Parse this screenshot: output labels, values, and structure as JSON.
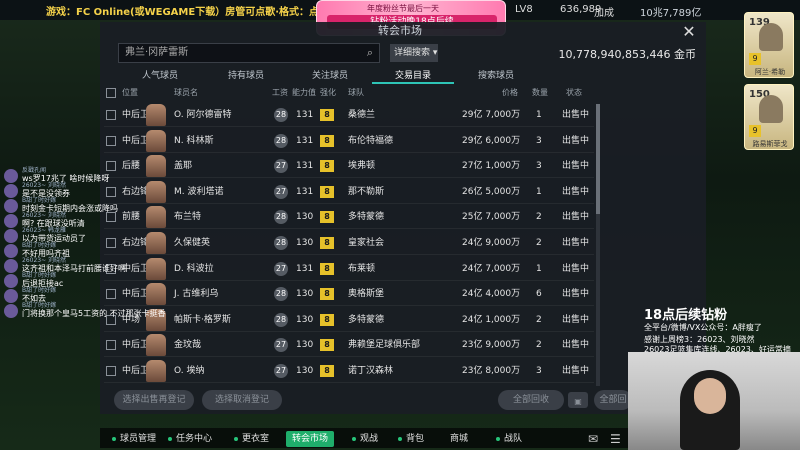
{
  "top": {
    "ticker": "游戏：FC Online(或WEGAME下载）房管可点歌·格式：点歌，歌名】",
    "promo_line1": "年度粉丝节最后一天",
    "promo_line2": "钻粉活动晚18点后续",
    "level": "LV8",
    "currency1": "636,989",
    "speed": "加成",
    "currency2": "10兆7,789亿"
  },
  "side_cards": [
    {
      "rating": "139",
      "level": "9",
      "name": "阿兰·希勒"
    },
    {
      "rating": "150",
      "level": "9",
      "name": "路易斯菲戈"
    }
  ],
  "dialog": {
    "title": "转会市场",
    "search_value": "弗兰·冈萨雷斯",
    "advanced_search": "详细搜索",
    "coins": "10,778,940,853,446 金币",
    "tabs": [
      "人气球员",
      "持有球员",
      "关注球员",
      "交易目录",
      "搜索球员"
    ],
    "active_tab": 3,
    "headers": {
      "position": "位置",
      "name": "球员名",
      "salary": "工资",
      "ability": "能力值",
      "enhance": "强化",
      "team": "球队",
      "price": "价格",
      "qty": "数量",
      "status": "状态"
    },
    "rows": [
      {
        "position": "中后卫",
        "name": "O. 阿尔德雷特",
        "salary": "28",
        "ability": "131",
        "enhance": "8",
        "team": "桑德兰",
        "price": "29亿 7,000万",
        "qty": "1",
        "status": "出售中"
      },
      {
        "position": "中后卫",
        "name": "N. 科林斯",
        "salary": "28",
        "ability": "131",
        "enhance": "8",
        "team": "布伦特福德",
        "price": "29亿 6,000万",
        "qty": "3",
        "status": "出售中"
      },
      {
        "position": "后腰",
        "name": "盖耶",
        "salary": "27",
        "ability": "131",
        "enhance": "8",
        "team": "埃弗顿",
        "price": "27亿 1,000万",
        "qty": "3",
        "status": "出售中"
      },
      {
        "position": "右边锋",
        "name": "M. 波利塔诺",
        "salary": "27",
        "ability": "131",
        "enhance": "8",
        "team": "那不勒斯",
        "price": "26亿 5,000万",
        "qty": "1",
        "status": "出售中"
      },
      {
        "position": "前腰",
        "name": "布兰特",
        "salary": "28",
        "ability": "130",
        "enhance": "8",
        "team": "多特蒙德",
        "price": "25亿 7,000万",
        "qty": "2",
        "status": "出售中"
      },
      {
        "position": "右边锋",
        "name": "久保健英",
        "salary": "28",
        "ability": "130",
        "enhance": "8",
        "team": "皇家社会",
        "price": "24亿 9,000万",
        "qty": "2",
        "status": "出售中"
      },
      {
        "position": "中后卫",
        "name": "D. 科波拉",
        "salary": "27",
        "ability": "131",
        "enhance": "8",
        "team": "布莱顿",
        "price": "24亿 7,000万",
        "qty": "1",
        "status": "出售中"
      },
      {
        "position": "中后卫",
        "name": "J. 古维利乌",
        "salary": "28",
        "ability": "130",
        "enhance": "8",
        "team": "奥格斯堡",
        "price": "24亿 4,000万",
        "qty": "6",
        "status": "出售中"
      },
      {
        "position": "中场",
        "name": "帕斯卡·格罗斯",
        "salary": "28",
        "ability": "130",
        "enhance": "8",
        "team": "多特蒙德",
        "price": "24亿 1,000万",
        "qty": "2",
        "status": "出售中"
      },
      {
        "position": "中后卫",
        "name": "金玟哉",
        "salary": "27",
        "ability": "130",
        "enhance": "8",
        "team": "弗赖堡足球俱乐部",
        "price": "23亿 9,000万",
        "qty": "2",
        "status": "出售中"
      },
      {
        "position": "中后卫",
        "name": "O. 埃纳",
        "salary": "27",
        "ability": "130",
        "enhance": "8",
        "team": "诺丁汉森林",
        "price": "23亿 8,000万",
        "qty": "3",
        "status": "出售中"
      }
    ],
    "footer": {
      "btn1": "选择出售再登记",
      "btn2": "选择取消登记",
      "btn3": "全部回收",
      "btn4": "全部回"
    }
  },
  "bottom_nav": [
    "球员管理",
    "任务中心",
    "更衣室",
    "转会市场",
    "观战",
    "背包",
    "商城",
    "战队"
  ],
  "bottom_nav_active": 3,
  "chat": [
    {
      "user": "反戳孔闻",
      "msg": "ws罗17兆了 啥时候降呀"
    },
    {
      "user": "26023~ 刘晓然",
      "msg": "是不是没领券"
    },
    {
      "user": "B甜了时好嫁",
      "msg": "时刻金卡短期内会涨或降吗"
    },
    {
      "user": "26023~ 刘晓然",
      "msg": "啊? 在跟球没听清"
    },
    {
      "user": "26023~ 韩龙雁",
      "msg": "以为带货运动员了"
    },
    {
      "user": "B甜了时好嫁",
      "msg": "不好用吗齐祖"
    },
    {
      "user": "26023~ 刘晓然",
      "msg": "这齐祖和本泽马打前腰谁好啊"
    },
    {
      "user": "B甜了时好嫁",
      "msg": "后退拒接ac"
    },
    {
      "user": "B甜了时好嫁",
      "msg": "不如去"
    },
    {
      "user": "B甜了时好嫁",
      "msg": "门将换那个皇马5工资的 不过那张卡挺香"
    }
  ],
  "overlay": {
    "headline": "18点后续钻粉",
    "line1": "全平台/微博/VX公众号：A胖瘦了",
    "line2": "感谢上周榜3：26023、刘晓然",
    "line3": "26023足篮集库连线、26023、好运常摘"
  }
}
